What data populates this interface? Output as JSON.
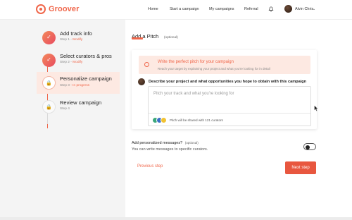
{
  "header": {
    "brand": "Groover",
    "nav": [
      "Home",
      "Start a campaign",
      "My campaigns",
      "Referral"
    ],
    "user_name": "Alvin Chris",
    "colors": {
      "accent": "#f0664a"
    }
  },
  "steps": [
    {
      "title": "Add track info",
      "step": "Step 1",
      "status": "Modify",
      "state": "done",
      "icon": "check-icon"
    },
    {
      "title": "Select curators & pros",
      "step": "Step 2",
      "status": "Modify",
      "state": "done",
      "icon": "check-icon"
    },
    {
      "title": "Personalize campaign",
      "step": "Step 3",
      "status": "In progress",
      "state": "active",
      "icon": "lock-icon"
    },
    {
      "title": "Review campaign",
      "step": "Step 4",
      "status": "",
      "state": "todo",
      "icon": "lock-icon"
    }
  ],
  "main": {
    "title": "Add a Pitch",
    "title_tag": "(optional)",
    "tip_title": "Write the perfect pitch for your campaign",
    "tip_sub": "Reach your target by explaining your project and what you're looking for in detail",
    "question": "Describe your project and what opportunities you hope to obtain with this campaign",
    "pitch_placeholder": "Pitch your track and what you're looking for",
    "shared_text": "Pitch will be shared with 121 curators",
    "personalized_title": "Add personalized messages?",
    "personalized_tag": "(optional)",
    "personalized_sub": "You can write messages to specific curators.",
    "prev_label": "Previous step",
    "next_label": "Next step"
  }
}
